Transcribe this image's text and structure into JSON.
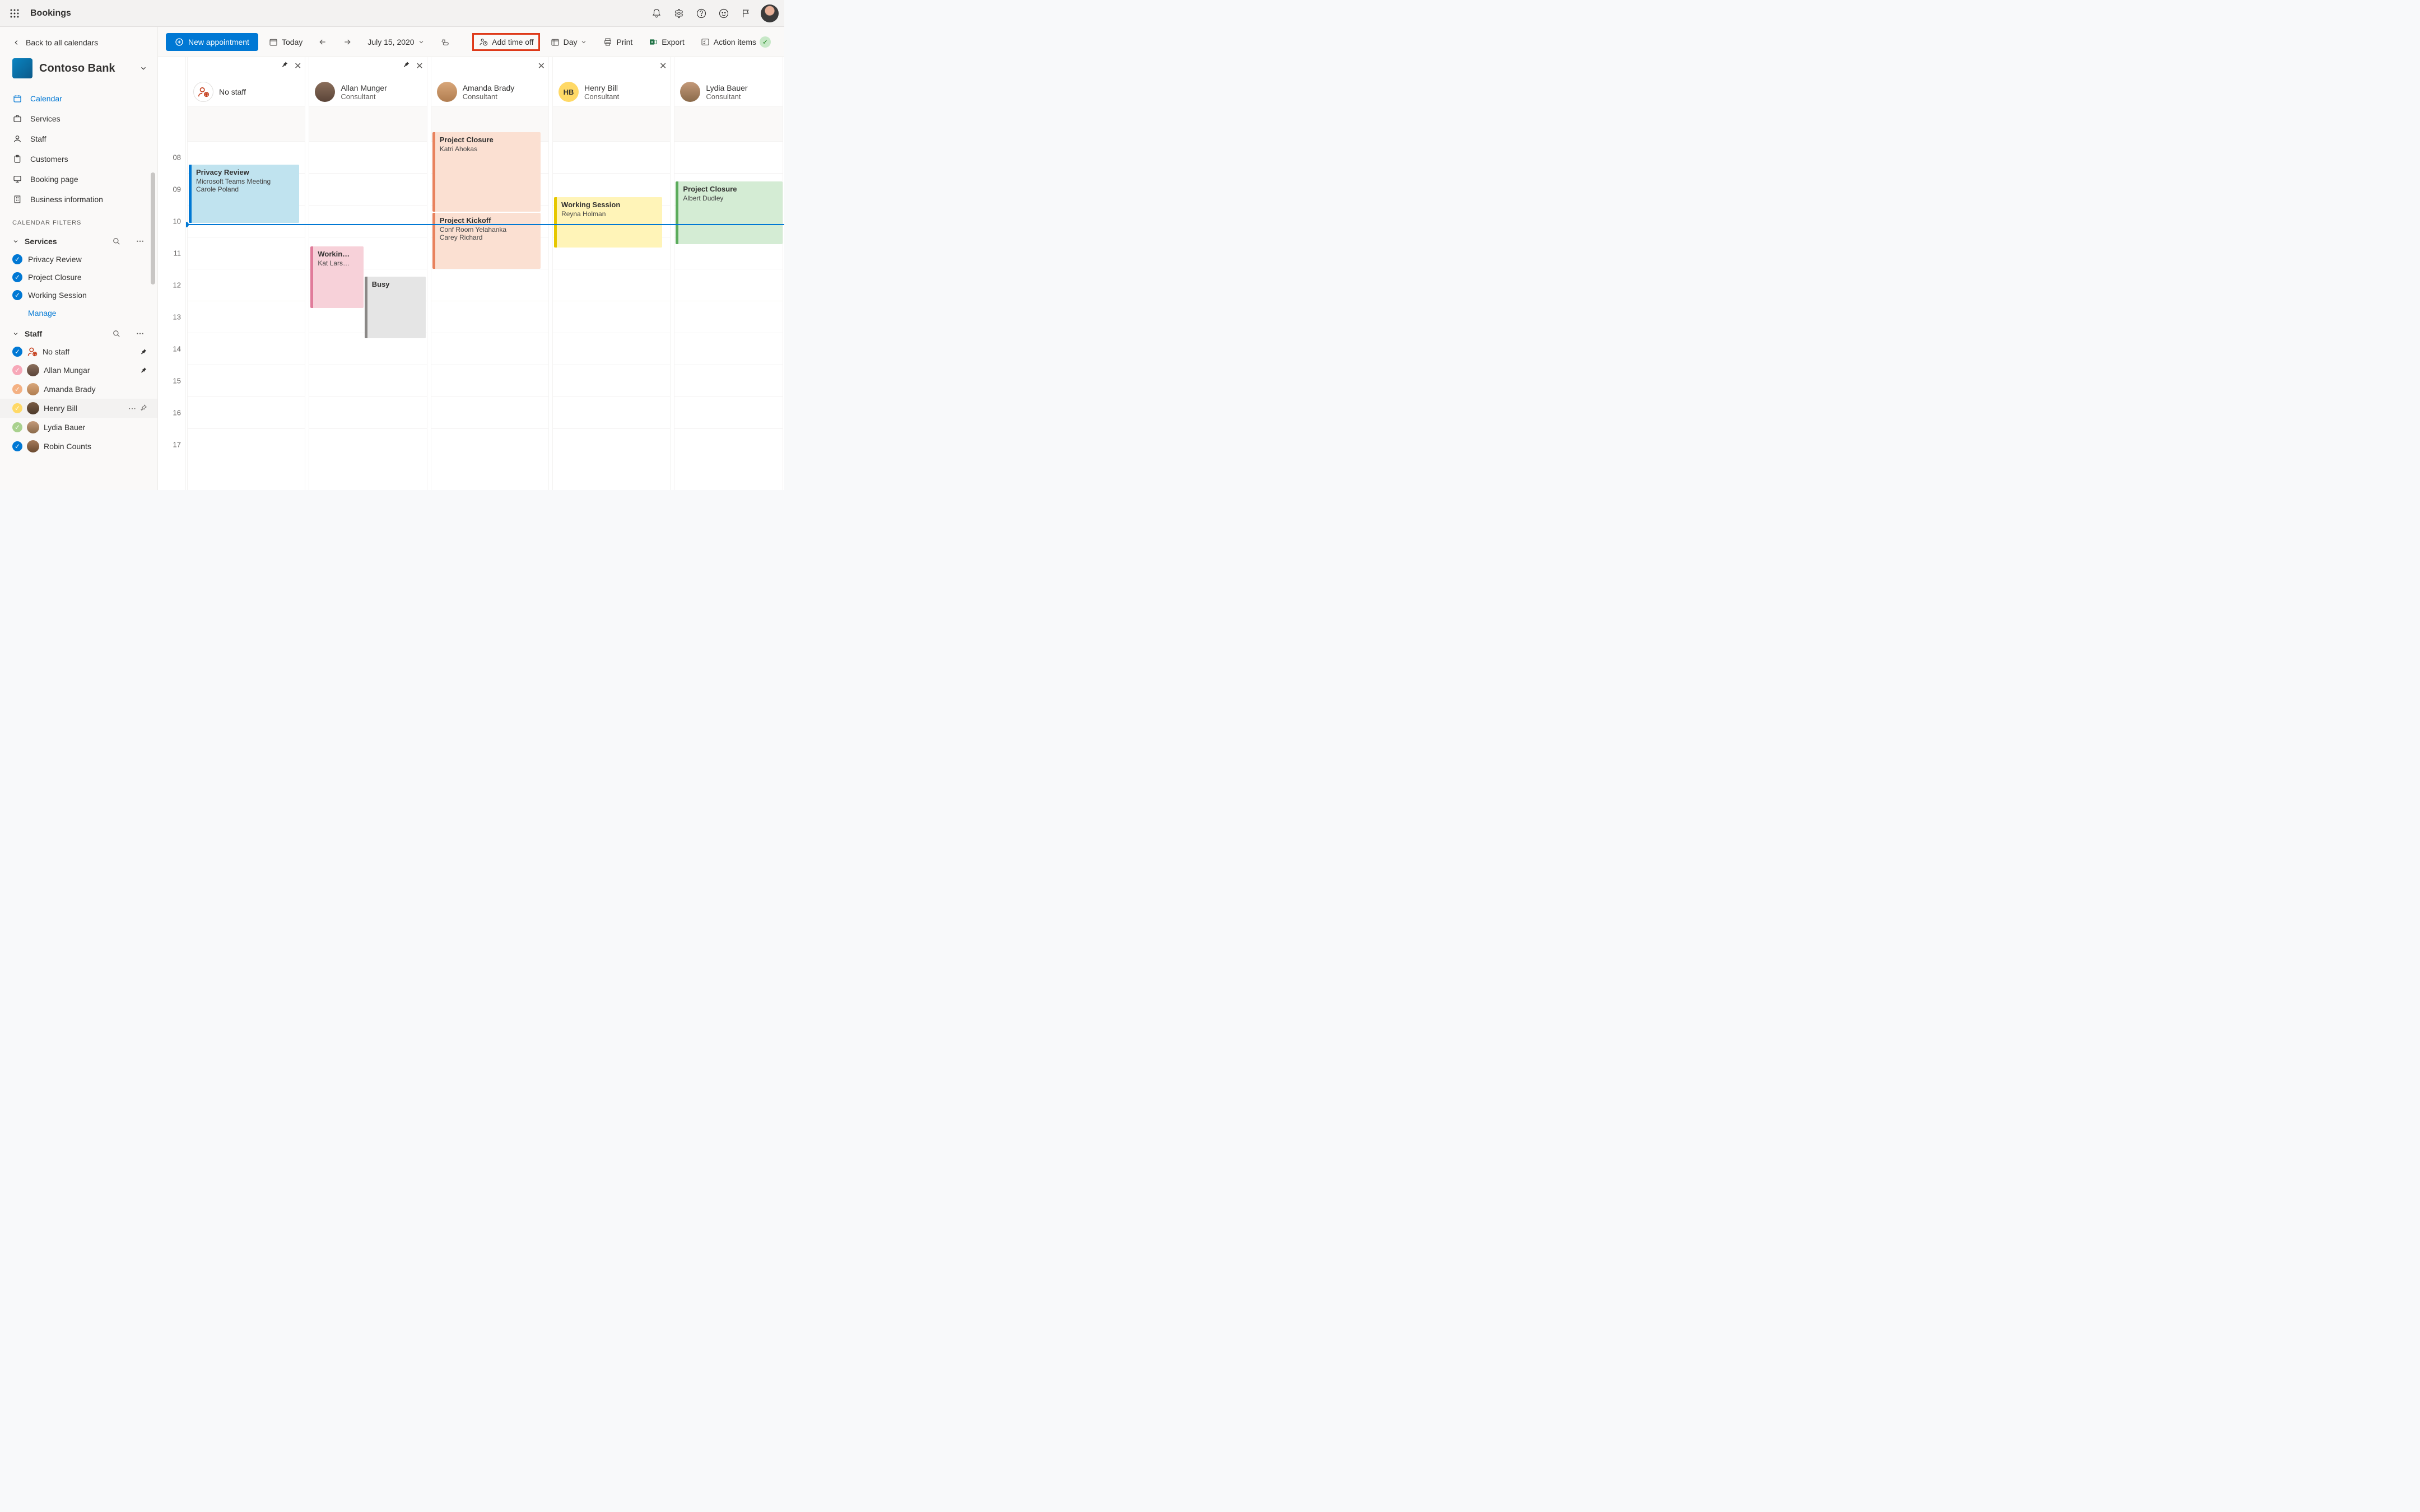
{
  "app_title": "Bookings",
  "back_link": "Back to all calendars",
  "org_name": "Contoso Bank",
  "nav": [
    {
      "icon": "calendar",
      "label": "Calendar",
      "active": true
    },
    {
      "icon": "briefcase",
      "label": "Services"
    },
    {
      "icon": "person",
      "label": "Staff"
    },
    {
      "icon": "clipboard",
      "label": "Customers"
    },
    {
      "icon": "monitor",
      "label": "Booking page"
    },
    {
      "icon": "building",
      "label": "Business information"
    }
  ],
  "filters_heading": "CALENDAR FILTERS",
  "services_header": "Services",
  "services": [
    {
      "label": "Privacy Review"
    },
    {
      "label": "Project Closure"
    },
    {
      "label": "Working Session"
    }
  ],
  "manage_label": "Manage",
  "staff_header": "Staff",
  "staff_filter": [
    {
      "label": "No staff",
      "dot": "teal",
      "no_avatar": true,
      "pinned": true
    },
    {
      "label": "Allan Mungar",
      "dot": "pink",
      "pinned": true
    },
    {
      "label": "Amanda Brady",
      "dot": "peach"
    },
    {
      "label": "Henry Bill",
      "dot": "yellow",
      "hovered": true
    },
    {
      "label": "Lydia Bauer",
      "dot": "green"
    },
    {
      "label": "Robin Counts",
      "dot": "teal"
    }
  ],
  "toolbar": {
    "new_appointment": "New appointment",
    "today": "Today",
    "date": "July 15, 2020",
    "add_time_off": "Add time off",
    "day": "Day",
    "print": "Print",
    "export": "Export",
    "action_items": "Action items"
  },
  "time_labels": [
    "08",
    "09",
    "10",
    "11",
    "12",
    "13",
    "14",
    "15",
    "16",
    "17"
  ],
  "columns": [
    {
      "name": "No staff",
      "role": "",
      "avatar_type": "nostaff",
      "pin": true,
      "close": true
    },
    {
      "name": "Allan Munger",
      "role": "Consultant",
      "avatar_type": "photo",
      "pin": true,
      "close": true
    },
    {
      "name": "Amanda Brady",
      "role": "Consultant",
      "avatar_type": "photo",
      "close": true
    },
    {
      "name": "Henry Bill",
      "role": "Consultant",
      "avatar_type": "initials",
      "initials": "HB",
      "color": "#ffd966",
      "close": true
    },
    {
      "name": "Lydia Bauer",
      "role": "Consultant",
      "avatar_type": "photo"
    }
  ],
  "events": {
    "privacy_review": {
      "title": "Privacy Review",
      "sub1": "Microsoft Teams Meeting",
      "sub2": "Carole Poland"
    },
    "project_closure_1": {
      "title": "Project Closure",
      "sub1": "Katri Ahokas"
    },
    "project_kickoff": {
      "title": "Project Kickoff",
      "sub1": "Conf Room Yelahanka",
      "sub2": "Carey Richard"
    },
    "working_session": {
      "title": "Working Session",
      "sub1": "Reyna Holman"
    },
    "project_closure_2": {
      "title": "Project Closure",
      "sub1": "Albert Dudley"
    },
    "workin_small": {
      "title": "Workin…",
      "sub1": "Kat Lars…"
    },
    "busy": {
      "title": "Busy"
    }
  }
}
